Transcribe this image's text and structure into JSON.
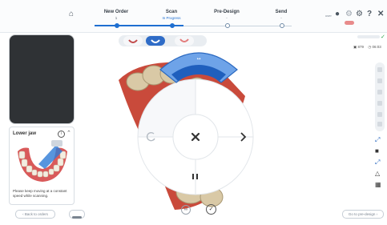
{
  "steps": [
    {
      "name": "New Order",
      "sub": "1"
    },
    {
      "name": "Scan",
      "sub": "In Progress"
    },
    {
      "name": "Pre-Design",
      "sub": "-"
    },
    {
      "name": "Send",
      "sub": "-"
    }
  ],
  "header": {
    "user_label": "user",
    "progress_fraction": 0.45
  },
  "lower_jaw": {
    "title": "Lower jaw",
    "tip": "Please keep moving at a constant speed while scanning."
  },
  "right_panel": {
    "size_label": "879",
    "time_label": "06:03"
  },
  "wheel": {
    "stop_icon": "close-icon",
    "next_icon": "chevron-right-icon",
    "pause_icon": "pause-icon",
    "rotate_icon": "rotate-icon"
  },
  "footer": {
    "back_label": "Back to orders",
    "save_label": "Go to pre-design"
  },
  "colors": {
    "accent": "#1f6fd1",
    "teeth": "#d8c9a8",
    "gum": "#c84a3a"
  }
}
